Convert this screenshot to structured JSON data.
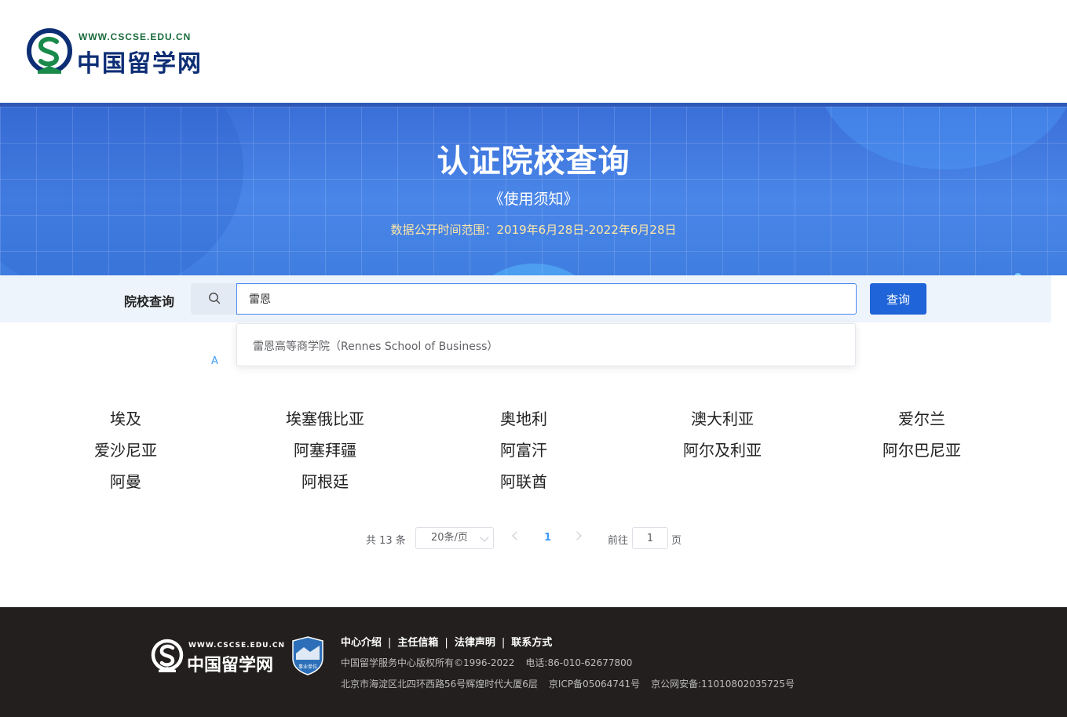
{
  "header": {
    "logo_url_text": "WWW.CSCSE.EDU.CN",
    "logo_name": "中国留学网"
  },
  "banner": {
    "title": "认证院校查询",
    "notice_link": "《使用须知》",
    "data_range": "数据公开时间范围：2019年6月28日-2022年6月28日"
  },
  "search": {
    "label": "院校查询",
    "input_value": "雷恩",
    "button_label": "查询",
    "suggestions": [
      "雷恩高等商学院（Rennes School of Business）"
    ]
  },
  "letter_filter": {
    "active_letter": "A"
  },
  "countries": [
    "埃及",
    "埃塞俄比亚",
    "奥地利",
    "澳大利亚",
    "爱尔兰",
    "爱沙尼亚",
    "阿塞拜疆",
    "阿富汗",
    "阿尔及利亚",
    "阿尔巴尼亚",
    "阿曼",
    "阿根廷",
    "阿联酋"
  ],
  "pagination": {
    "total_text": "共 13 条",
    "page_size": "20条/页",
    "current_page": "1",
    "goto_label": "前往",
    "goto_value": "1",
    "goto_suffix": "页"
  },
  "footer": {
    "logo_url_text": "WWW.CSCSE.EDU.CN",
    "logo_name": "中国留学网",
    "badge_text": "事业单位",
    "links": [
      "中心介绍",
      "主任信箱",
      "法律声明",
      "联系方式"
    ],
    "link_separator": "|",
    "copyright": "中国留学服务中心版权所有©1996-2022",
    "phone": "电话:86-010-62677800",
    "address": "北京市海淀区北四环西路56号辉煌时代大厦6层",
    "icp": "京ICP备05064741号",
    "police": "京公网安备:11010802035725号"
  },
  "colors": {
    "primary": "#1f64d8",
    "banner_blue": "#4a86e8",
    "link_blue": "#409eff",
    "footer_bg": "#231f1e"
  }
}
